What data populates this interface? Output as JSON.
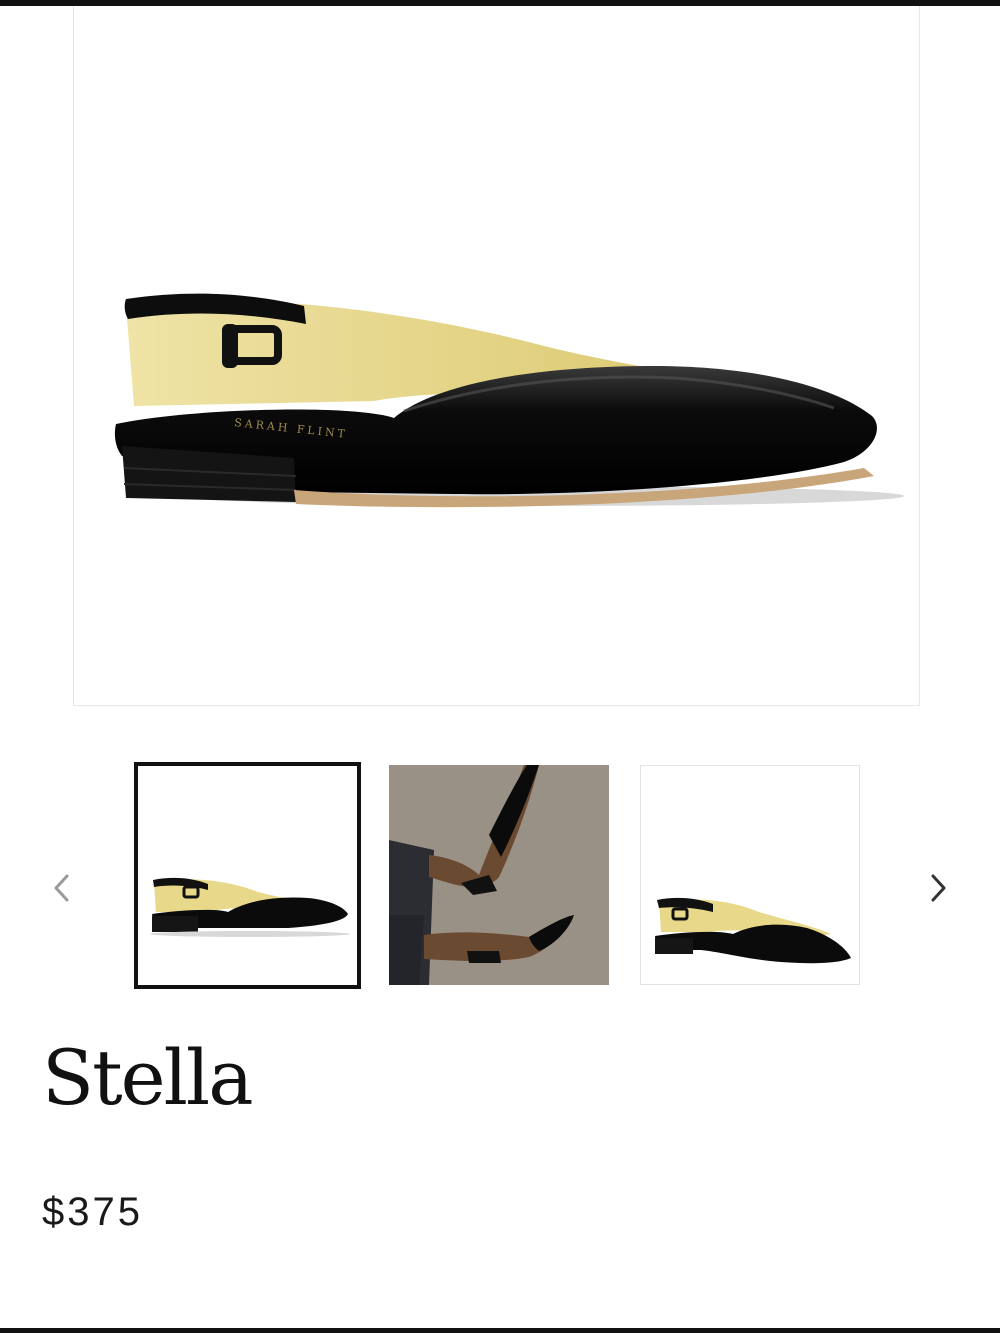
{
  "gallery": {
    "main_image": {
      "alt": "black-patent-slingback-flat-side-view"
    },
    "prev_icon": "chevron-left-icon",
    "next_icon": "chevron-right-icon",
    "thumbnails": [
      {
        "label": "side-view",
        "selected": true
      },
      {
        "label": "on-model",
        "selected": false
      },
      {
        "label": "three-quarter-view",
        "selected": false
      }
    ]
  },
  "product": {
    "brand_stamp": "SARAH FLINT",
    "name": "Stella",
    "price": "$375"
  },
  "colors": {
    "bar": "#111111",
    "patent_black": "#0c0c0c",
    "lining": "#e8d98a",
    "thumb_bg_model": "#9a9186"
  }
}
